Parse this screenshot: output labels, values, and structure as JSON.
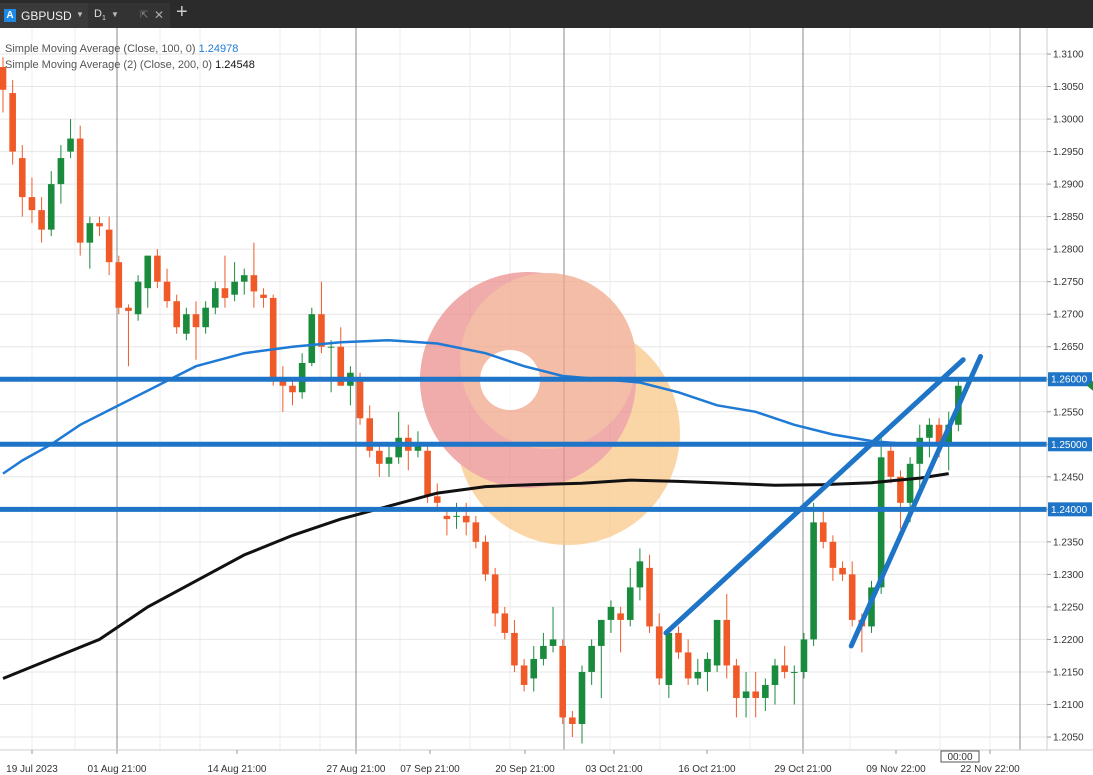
{
  "tabs": [
    {
      "symbol_badge": "A",
      "symbol": "GBPUSD"
    },
    {
      "timeframe": "D",
      "timeframe_sub": "1"
    }
  ],
  "indicators": [
    {
      "name": "Simple Moving Average (Close, 100, 0)",
      "value": "1.24978",
      "color": "#1e7ad4"
    },
    {
      "name": "Simple Moving Average (2) (Close, 200, 0)",
      "value": "1.24548",
      "color": "#111111"
    }
  ],
  "icons": {
    "close": "close-icon",
    "popout": "popout-icon",
    "add_tab": "plus-icon",
    "dropdown": "chevron-down-icon"
  },
  "chart_data": {
    "type": "candlestick",
    "symbol": "GBPUSD",
    "timeframe": "D1",
    "ylim": [
      1.203,
      1.314
    ],
    "y_ticks": [
      "1.3100",
      "1.3050",
      "1.3000",
      "1.2950",
      "1.2900",
      "1.2850",
      "1.2800",
      "1.2750",
      "1.2700",
      "1.2650",
      "1.2600",
      "1.2550",
      "1.2500",
      "1.2450",
      "1.2400",
      "1.2350",
      "1.2300",
      "1.2250",
      "1.2200",
      "1.2150",
      "1.2100",
      "1.2050"
    ],
    "x_labels": [
      "19 Jul 2023",
      "01 Aug 21:00",
      "14 Aug 21:00",
      "27 Aug 21:00",
      "07 Sep 21:00",
      "20 Sep 21:00",
      "03 Oct 21:00",
      "16 Oct 21:00",
      "29 Oct 21:00",
      "09 Nov 22:00",
      "22 Nov 22:00"
    ],
    "crosshair_time": "00:00",
    "colors": {
      "up": "#1a8a3c",
      "down": "#f05a28",
      "lines": "#1e74c6",
      "sma200": "#111111"
    },
    "candles": [
      [
        1.308,
        1.3095,
        1.301,
        1.3045
      ],
      [
        1.304,
        1.306,
        1.293,
        1.295
      ],
      [
        1.294,
        1.296,
        1.285,
        1.288
      ],
      [
        1.288,
        1.291,
        1.284,
        1.286
      ],
      [
        1.286,
        1.288,
        1.281,
        1.283
      ],
      [
        1.283,
        1.292,
        1.282,
        1.29
      ],
      [
        1.29,
        1.296,
        1.287,
        1.294
      ],
      [
        1.295,
        1.3,
        1.294,
        1.297
      ],
      [
        1.297,
        1.299,
        1.279,
        1.281
      ],
      [
        1.281,
        1.285,
        1.277,
        1.284
      ],
      [
        1.284,
        1.285,
        1.282,
        1.2835
      ],
      [
        1.283,
        1.285,
        1.276,
        1.278
      ],
      [
        1.278,
        1.279,
        1.27,
        1.271
      ],
      [
        1.271,
        1.2715,
        1.262,
        1.2705
      ],
      [
        1.27,
        1.276,
        1.269,
        1.275
      ],
      [
        1.274,
        1.279,
        1.271,
        1.279
      ],
      [
        1.279,
        1.28,
        1.274,
        1.275
      ],
      [
        1.275,
        1.277,
        1.271,
        1.272
      ],
      [
        1.272,
        1.273,
        1.267,
        1.268
      ],
      [
        1.267,
        1.271,
        1.266,
        1.27
      ],
      [
        1.27,
        1.272,
        1.263,
        1.268
      ],
      [
        1.268,
        1.272,
        1.267,
        1.271
      ],
      [
        1.271,
        1.275,
        1.27,
        1.274
      ],
      [
        1.274,
        1.279,
        1.271,
        1.2725
      ],
      [
        1.273,
        1.278,
        1.272,
        1.275
      ],
      [
        1.275,
        1.277,
        1.273,
        1.276
      ],
      [
        1.276,
        1.281,
        1.271,
        1.2735
      ],
      [
        1.273,
        1.274,
        1.271,
        1.2725
      ],
      [
        1.2725,
        1.273,
        1.259,
        1.26
      ],
      [
        1.26,
        1.262,
        1.255,
        1.259
      ],
      [
        1.259,
        1.26,
        1.256,
        1.258
      ],
      [
        1.258,
        1.264,
        1.257,
        1.2625
      ],
      [
        1.2625,
        1.271,
        1.262,
        1.27
      ],
      [
        1.27,
        1.275,
        1.264,
        1.265
      ],
      [
        1.265,
        1.266,
        1.258,
        1.265
      ],
      [
        1.265,
        1.268,
        1.259,
        1.259
      ],
      [
        1.259,
        1.262,
        1.256,
        1.261
      ],
      [
        1.26,
        1.261,
        1.253,
        1.254
      ],
      [
        1.254,
        1.256,
        1.248,
        1.249
      ],
      [
        1.249,
        1.25,
        1.245,
        1.247
      ],
      [
        1.247,
        1.25,
        1.245,
        1.248
      ],
      [
        1.248,
        1.255,
        1.247,
        1.251
      ],
      [
        1.251,
        1.253,
        1.246,
        1.249
      ],
      [
        1.249,
        1.252,
        1.248,
        1.25
      ],
      [
        1.249,
        1.25,
        1.241,
        1.242
      ],
      [
        1.242,
        1.244,
        1.24,
        1.241
      ],
      [
        1.239,
        1.24,
        1.236,
        1.2385
      ],
      [
        1.239,
        1.241,
        1.237,
        1.239
      ],
      [
        1.239,
        1.241,
        1.236,
        1.238
      ],
      [
        1.238,
        1.239,
        1.234,
        1.235
      ],
      [
        1.235,
        1.236,
        1.229,
        1.23
      ],
      [
        1.23,
        1.231,
        1.222,
        1.224
      ],
      [
        1.224,
        1.225,
        1.22,
        1.221
      ],
      [
        1.221,
        1.223,
        1.215,
        1.216
      ],
      [
        1.216,
        1.217,
        1.212,
        1.213
      ],
      [
        1.214,
        1.219,
        1.212,
        1.217
      ],
      [
        1.217,
        1.221,
        1.216,
        1.219
      ],
      [
        1.219,
        1.225,
        1.218,
        1.22
      ],
      [
        1.219,
        1.22,
        1.207,
        1.208
      ],
      [
        1.208,
        1.209,
        1.205,
        1.207
      ],
      [
        1.207,
        1.216,
        1.204,
        1.215
      ],
      [
        1.215,
        1.22,
        1.213,
        1.219
      ],
      [
        1.219,
        1.223,
        1.211,
        1.223
      ],
      [
        1.223,
        1.226,
        1.221,
        1.225
      ],
      [
        1.224,
        1.225,
        1.218,
        1.223
      ],
      [
        1.223,
        1.231,
        1.222,
        1.228
      ],
      [
        1.228,
        1.234,
        1.226,
        1.232
      ],
      [
        1.231,
        1.233,
        1.221,
        1.222
      ],
      [
        1.222,
        1.224,
        1.213,
        1.214
      ],
      [
        1.213,
        1.221,
        1.211,
        1.221
      ],
      [
        1.221,
        1.222,
        1.217,
        1.218
      ],
      [
        1.218,
        1.22,
        1.213,
        1.214
      ],
      [
        1.214,
        1.217,
        1.213,
        1.215
      ],
      [
        1.215,
        1.218,
        1.212,
        1.217
      ],
      [
        1.216,
        1.223,
        1.215,
        1.223
      ],
      [
        1.223,
        1.227,
        1.214,
        1.216
      ],
      [
        1.216,
        1.217,
        1.208,
        1.211
      ],
      [
        1.211,
        1.215,
        1.208,
        1.212
      ],
      [
        1.212,
        1.215,
        1.208,
        1.211
      ],
      [
        1.211,
        1.214,
        1.209,
        1.213
      ],
      [
        1.213,
        1.217,
        1.21,
        1.216
      ],
      [
        1.216,
        1.219,
        1.214,
        1.215
      ],
      [
        1.215,
        1.216,
        1.21,
        1.215
      ],
      [
        1.215,
        1.221,
        1.214,
        1.22
      ],
      [
        1.22,
        1.241,
        1.219,
        1.238
      ],
      [
        1.238,
        1.24,
        1.234,
        1.235
      ],
      [
        1.235,
        1.236,
        1.229,
        1.231
      ],
      [
        1.231,
        1.232,
        1.229,
        1.23
      ],
      [
        1.23,
        1.232,
        1.222,
        1.223
      ],
      [
        1.223,
        1.224,
        1.218,
        1.222
      ],
      [
        1.222,
        1.229,
        1.221,
        1.228
      ],
      [
        1.228,
        1.251,
        1.227,
        1.248
      ],
      [
        1.249,
        1.25,
        1.244,
        1.245
      ],
      [
        1.245,
        1.246,
        1.237,
        1.241
      ],
      [
        1.241,
        1.248,
        1.238,
        1.247
      ],
      [
        1.247,
        1.253,
        1.242,
        1.251
      ],
      [
        1.251,
        1.254,
        1.248,
        1.253
      ],
      [
        1.253,
        1.254,
        1.248,
        1.25
      ],
      [
        1.25,
        1.255,
        1.246,
        1.253
      ],
      [
        1.253,
        1.26,
        1.252,
        1.259
      ]
    ],
    "sma100": [
      [
        0,
        1.2455
      ],
      [
        2,
        1.2475
      ],
      [
        5,
        1.25
      ],
      [
        8,
        1.253
      ],
      [
        12,
        1.256
      ],
      [
        16,
        1.259
      ],
      [
        20,
        1.262
      ],
      [
        25,
        1.264
      ],
      [
        30,
        1.265
      ],
      [
        35,
        1.2657
      ],
      [
        40,
        1.266
      ],
      [
        45,
        1.2655
      ],
      [
        50,
        1.264
      ],
      [
        54,
        1.262
      ],
      [
        58,
        1.2605
      ],
      [
        62,
        1.26
      ],
      [
        66,
        1.2595
      ],
      [
        70,
        1.258
      ],
      [
        74,
        1.256
      ],
      [
        78,
        1.255
      ],
      [
        82,
        1.253
      ],
      [
        86,
        1.2515
      ],
      [
        90,
        1.2505
      ],
      [
        94,
        1.25
      ],
      [
        98,
        1.2498
      ]
    ],
    "sma200": [
      [
        0,
        1.214
      ],
      [
        5,
        1.217
      ],
      [
        10,
        1.22
      ],
      [
        15,
        1.225
      ],
      [
        20,
        1.229
      ],
      [
        25,
        1.233
      ],
      [
        30,
        1.236
      ],
      [
        35,
        1.2385
      ],
      [
        40,
        1.2405
      ],
      [
        45,
        1.2425
      ],
      [
        50,
        1.2435
      ],
      [
        55,
        1.2438
      ],
      [
        60,
        1.244
      ],
      [
        65,
        1.2445
      ],
      [
        70,
        1.2443
      ],
      [
        75,
        1.244
      ],
      [
        80,
        1.2437
      ],
      [
        85,
        1.2438
      ],
      [
        90,
        1.2441
      ],
      [
        95,
        1.2448
      ],
      [
        98,
        1.2455
      ]
    ],
    "horizontal_levels": [
      {
        "price": 1.26,
        "label": "1.26000"
      },
      {
        "price": 1.25,
        "label": "1.25000"
      },
      {
        "price": 1.24,
        "label": "1.24000"
      }
    ],
    "trendlines": [
      [
        [
          68.7,
          1.221
        ],
        [
          99.5,
          1.263
        ]
      ],
      [
        [
          87.9,
          1.219
        ],
        [
          101.3,
          1.2635
        ]
      ]
    ],
    "last_price": 1.259
  }
}
